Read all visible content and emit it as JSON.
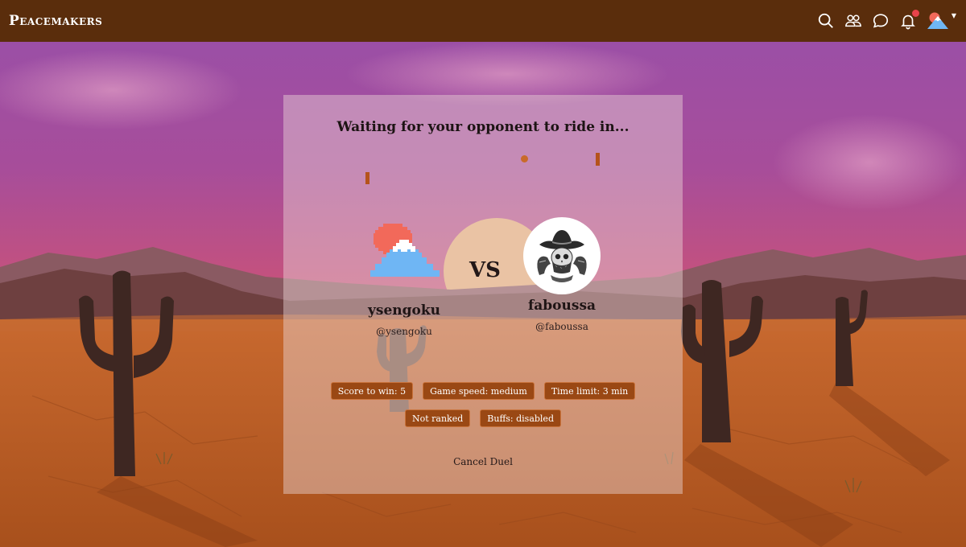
{
  "header": {
    "brand": "Peacemakers",
    "icons": [
      "search-icon",
      "friends-icon",
      "chat-icon",
      "bell-icon",
      "profile-avatar"
    ],
    "has_notification": true
  },
  "modal": {
    "title": "Waiting for your opponent to ride in...",
    "vs": "VS",
    "player_left": {
      "name": "ysengoku",
      "handle": "@ysengoku"
    },
    "player_right": {
      "name": "faboussa",
      "handle": "@faboussa"
    },
    "settings": [
      "Score to win: 5",
      "Game speed: medium",
      "Time limit: 3 min",
      "Not ranked",
      "Buffs: disabled"
    ],
    "cancel": "Cancel Duel"
  },
  "colors": {
    "header_bg": "#5a2d0c",
    "chip_bg": "#9a4814",
    "notification": "#e8434a",
    "avatar_sun": "#f2695a",
    "avatar_mountain": "#6fb6f4"
  }
}
